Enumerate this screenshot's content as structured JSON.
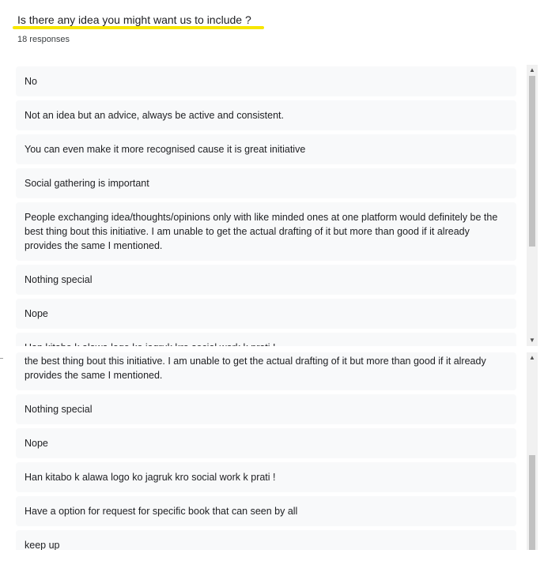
{
  "question": {
    "title": "Is there any idea you might want us to include ?",
    "response_count": "18 responses"
  },
  "panel1": {
    "responses": [
      "No",
      "Not an idea but an advice, always be active and consistent.",
      "You can even make it more recognised cause it is great initiative",
      "Social gathering is important",
      "People exchanging idea/thoughts/opinions only with like minded ones at one platform would definitely be the best thing bout this initiative. I am unable to get the actual drafting of it but more than good if it already provides the same I mentioned.",
      "Nothing special",
      "Nope",
      "Han kitabo k alawa logo ko jagruk kro social work k prati !"
    ]
  },
  "panel2": {
    "partial_response": "the best thing bout this initiative. I am unable to get the actual drafting of it but more than good if it already provides the same I mentioned.",
    "responses": [
      "Nothing special",
      "Nope",
      "Han kitabo k alawa logo ko jagruk kro social work k prati !",
      "Have a option for request for specific book that can seen by all",
      "keep up"
    ]
  },
  "scrollbar": {
    "up_arrow": "▲",
    "down_arrow": "▼"
  },
  "colors": {
    "highlight": "#f7e600",
    "card_background": "#f8f9fa",
    "scroll_thumb": "#c1c1c1"
  }
}
